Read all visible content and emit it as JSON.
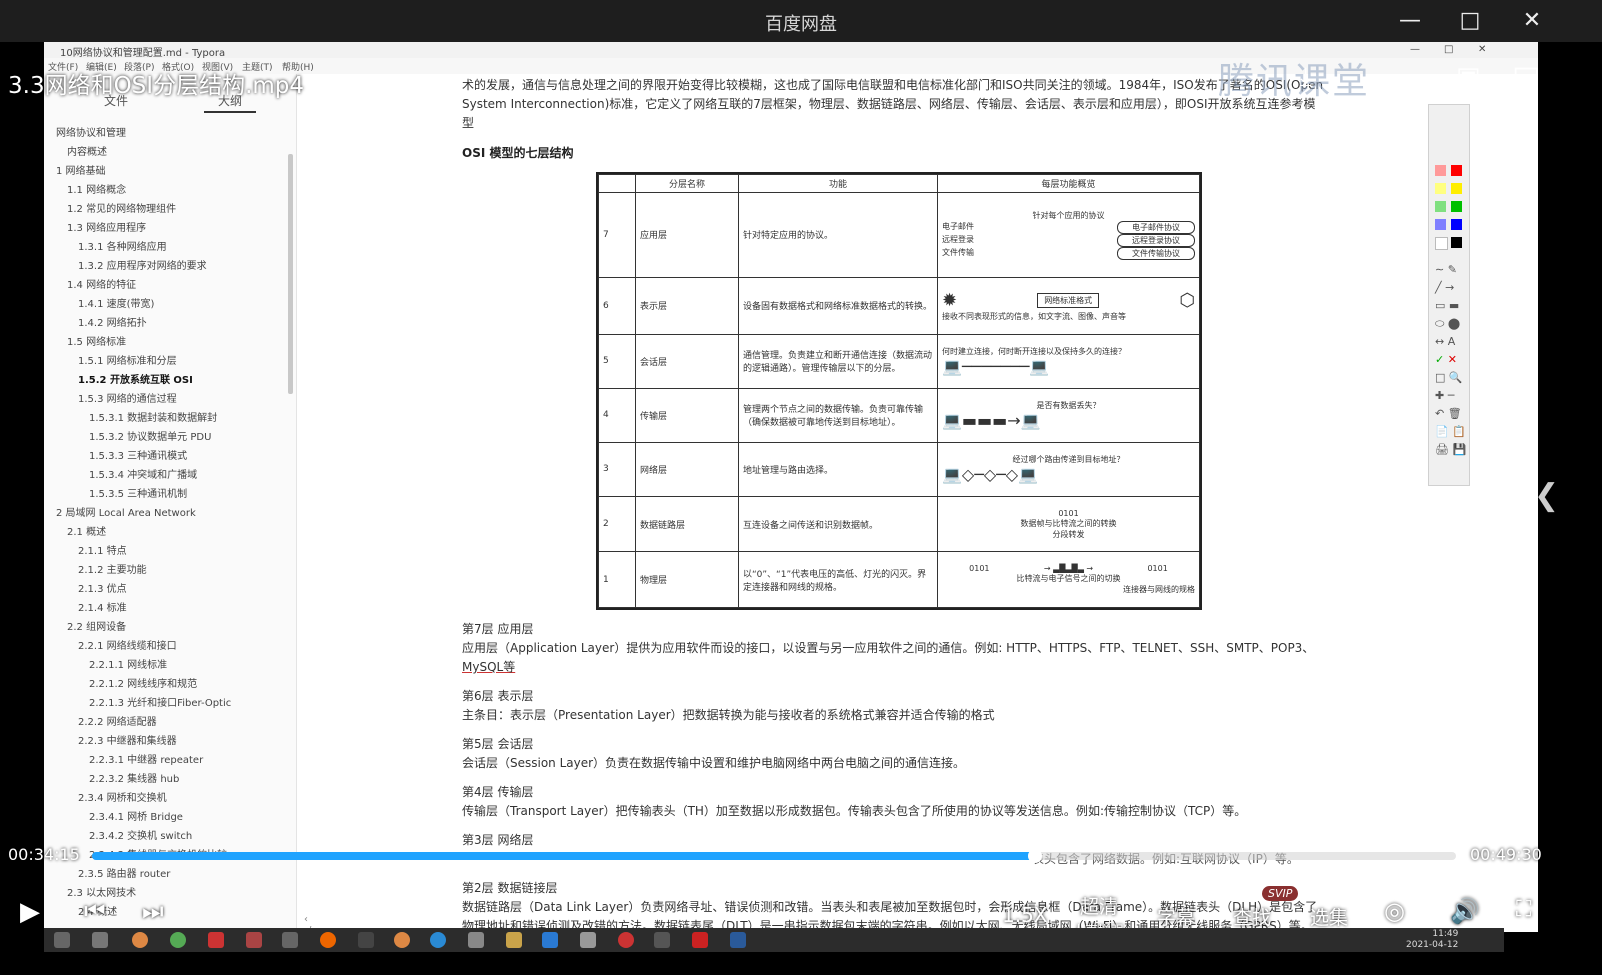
{
  "player": {
    "app_title": "百度网盘",
    "file_name": "3.3网络和OSI分层结构.mp4",
    "watermark": "腾讯课堂",
    "time_current": "00:34:15",
    "time_total": "00:49:30",
    "progress": 0.691,
    "speed": "1.5X",
    "quality": "超清",
    "quality_sub": "人声增强",
    "subtitle_label": "字幕",
    "find_label": "查找",
    "episodes_label": "选集",
    "svip_badge": "SVIP"
  },
  "typora": {
    "window_title": "10网络协议和管理配置.md - Typora",
    "menu": [
      "文件(F)",
      "编辑(E)",
      "段落(P)",
      "格式(O)",
      "视图(V)",
      "主题(T)",
      "帮助(H)"
    ],
    "tabs": [
      "文件",
      "大纲"
    ],
    "toc": [
      {
        "label": "网络协议和管理",
        "level": 0
      },
      {
        "label": "内容概述",
        "level": 1
      },
      {
        "label": "1 网络基础",
        "level": 0
      },
      {
        "label": "1.1 网络概念",
        "level": 1
      },
      {
        "label": "1.2 常见的网络物理组件",
        "level": 1
      },
      {
        "label": "1.3 网络应用程序",
        "level": 1
      },
      {
        "label": "1.3.1 各种网络应用",
        "level": 2
      },
      {
        "label": "1.3.2 应用程序对网络的要求",
        "level": 2
      },
      {
        "label": "1.4 网络的特征",
        "level": 1
      },
      {
        "label": "1.4.1 速度(带宽)",
        "level": 2
      },
      {
        "label": "1.4.2 网络拓扑",
        "level": 2
      },
      {
        "label": "1.5 网络标准",
        "level": 1
      },
      {
        "label": "1.5.1 网络标准和分层",
        "level": 2
      },
      {
        "label": "1.5.2 开放系统互联 OSI",
        "level": 2,
        "active": true
      },
      {
        "label": "1.5.3 网络的通信过程",
        "level": 2
      },
      {
        "label": "1.5.3.1 数据封装和数据解封",
        "level": 3
      },
      {
        "label": "1.5.3.2 协议数据单元 PDU",
        "level": 3
      },
      {
        "label": "1.5.3.3 三种通讯模式",
        "level": 3
      },
      {
        "label": "1.5.3.4 冲突域和广播域",
        "level": 3
      },
      {
        "label": "1.5.3.5 三种通讯机制",
        "level": 3
      },
      {
        "label": "2 局域网 Local Area Network",
        "level": 0
      },
      {
        "label": "2.1 概述",
        "level": 1
      },
      {
        "label": "2.1.1 特点",
        "level": 2
      },
      {
        "label": "2.1.2 主要功能",
        "level": 2
      },
      {
        "label": "2.1.3 优点",
        "level": 2
      },
      {
        "label": "2.1.4 标准",
        "level": 2
      },
      {
        "label": "2.2 组网设备",
        "level": 1
      },
      {
        "label": "2.2.1 网络线缆和接口",
        "level": 2
      },
      {
        "label": "2.2.1.1 网线标准",
        "level": 3
      },
      {
        "label": "2.2.1.2 网线线序和规范",
        "level": 3
      },
      {
        "label": "2.2.1.3 光纤和接口Fiber-Optic",
        "level": 3
      },
      {
        "label": "2.2.2 网络适配器",
        "level": 2
      },
      {
        "label": "2.2.3 中继器和集线器",
        "level": 2
      },
      {
        "label": "2.2.3.1 中继器 repeater",
        "level": 3
      },
      {
        "label": "2.2.3.2 集线器 hub",
        "level": 3
      },
      {
        "label": "2.3.4 网桥和交换机",
        "level": 2
      },
      {
        "label": "2.3.4.1 网桥 Bridge",
        "level": 3
      },
      {
        "label": "2.3.4.2 交换机 switch",
        "level": 3
      },
      {
        "label": "2.3.4.3 集线器与交换机的比较",
        "level": 3
      },
      {
        "label": "2.3.5 路由器 router",
        "level": 2
      },
      {
        "label": "2.3 以太网技术",
        "level": 1
      },
      {
        "label": "2.4 概述",
        "level": 2
      }
    ],
    "doc": {
      "intro_1": "术的发展，通信与信息处理之间的界限开始变得比较模糊，这也成了国际电信联盟和电信标准化部门和ISO共同关注的领域。1984年，ISO发布了著名的OSI(Open",
      "intro_2": "System Interconnection)标准，它定义了网络互联的7层框架，物理层、数据链路层、网络层、传输层、会话层、表示层和应用层），即OSI开放系统互连参考模",
      "intro_3": "型",
      "section_title": "OSI 模型的七层结构",
      "layer7_h": "第7层 应用层",
      "layer7_p1": "应用层（Application Layer）提供为应用软件而设的接口，以设置与另一应用软件之间的通信。例如: HTTP、HTTPS、FTP、TELNET、SSH、SMTP、POP3、",
      "layer7_p2": "MySQL等",
      "layer6_h": "第6层 表示层",
      "layer6_p": "主条目：表示层（Presentation Layer）把数据转换为能与接收者的系统格式兼容并适合传输的格式",
      "layer5_h": "第5层 会话层",
      "layer5_p": "会话层（Session Layer）负责在数据传输中设置和维护电脑网络中两台电脑之间的通信连接。",
      "layer4_h": "第4层 传输层",
      "layer4_p": "传输层（Transport Layer）把传输表头（TH）加至数据以形成数据包。传输表头包含了所使用的协议等发送信息。例如:传输控制协议（TCP）等。",
      "layer3_h": "第3层 网络层",
      "layer3_p": "表头包含了网络数据。例如:互联网协议（IP）等。",
      "layer2_h": "第2层 数据链接层",
      "layer2_p": "数据链路层（Data Link Layer）负责网络寻址、错误侦测和改错。当表头和表尾被加至数据包时，会形成信息框（Data Frame）。数据链表头（DLH）是包含了",
      "layer2_p2": "物理地址和错误侦测及改错的方法。数据链表尾（DLT）是一串指示数据包末端的字符串。例如以太网、无线局域网（Wi-Fi）和通用分组无线服务（GPRS）等。"
    },
    "osi_table": {
      "headers": [
        "分层名称",
        "功能",
        "每层功能概览"
      ],
      "rows": [
        {
          "num": "7",
          "name": "应用层",
          "func": "针对特定应用的协议。",
          "overview": "针对每个应用的协议",
          "items": [
            "电子邮件",
            "远程登录",
            "文件传输"
          ],
          "protocols": [
            "电子邮件协议",
            "远程登录协议",
            "文件传输协议"
          ]
        },
        {
          "num": "6",
          "name": "表示层",
          "func": "设备固有数据格式和网络标准数据格式的转换。",
          "overview": "接收不同表现形式的信息，如文字流、图像、声音等",
          "box": "网络标准格式"
        },
        {
          "num": "5",
          "name": "会话层",
          "func": "通信管理。负责建立和断开通信连接（数据流动的逻辑通路）。管理传输层以下的分层。",
          "overview": "何时建立连接，何时断开连接以及保持多久的连接？"
        },
        {
          "num": "4",
          "name": "传输层",
          "func": "管理两个节点之间的数据传输。负责可靠传输（确保数据被可靠地传送到目标地址）。",
          "overview": "是否有数据丢失？"
        },
        {
          "num": "3",
          "name": "网络层",
          "func": "地址管理与路由选择。",
          "overview": "经过哪个路由传递到目标地址？"
        },
        {
          "num": "2",
          "name": "数据链路层",
          "func": "互连设备之间传送和识别数据帧。",
          "overview": "数据帧与比特流之间的转换",
          "sub": "分段转发",
          "bits": "0101"
        },
        {
          "num": "1",
          "name": "物理层",
          "func": "以“0”、“1”代表电压的高低、灯光的闪灭。界定连接器和网线的规格。",
          "overview": "比特流与电子信号之间的切换",
          "sub": "连接器与网线的规格",
          "bits_l": "0101",
          "bits_r": "0101"
        }
      ]
    }
  },
  "taskbar": {
    "time": "11:49",
    "date": "2021-04-12"
  }
}
